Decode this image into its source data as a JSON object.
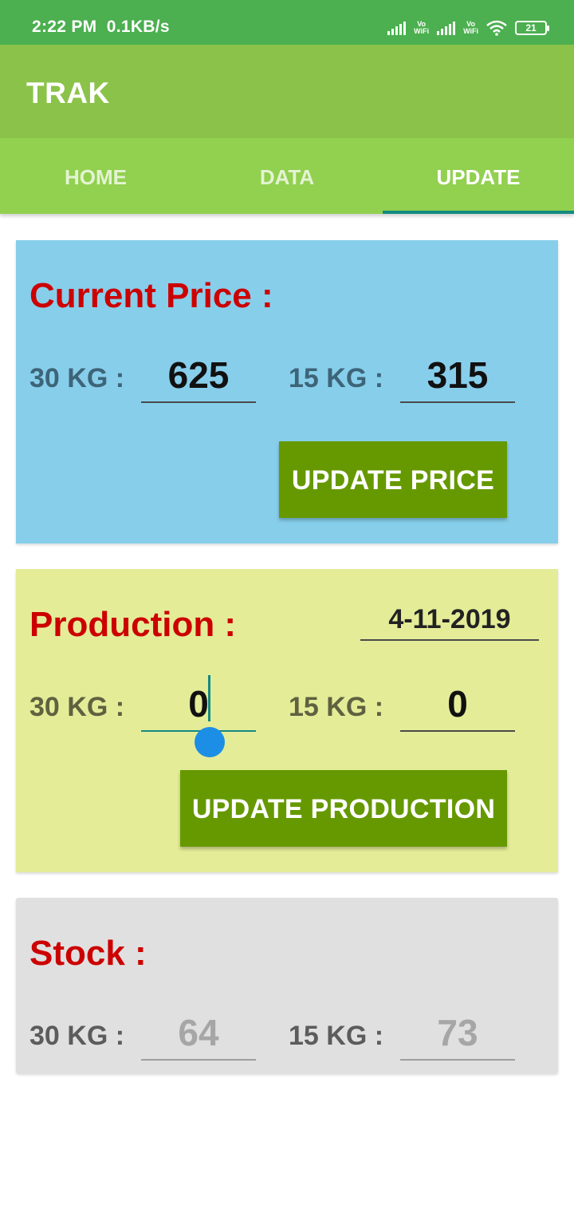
{
  "status_bar": {
    "time": "2:22 PM",
    "speed": "0.1KB/s",
    "vowifi_label": "Vo\nWiFi",
    "battery": "21"
  },
  "app": {
    "title": "TRAK"
  },
  "tabs": [
    {
      "label": "HOME",
      "active": false
    },
    {
      "label": "DATA",
      "active": false
    },
    {
      "label": "UPDATE",
      "active": true
    }
  ],
  "current_price": {
    "heading": "Current Price :",
    "label_30": "30 KG :",
    "label_15": "15 KG :",
    "value_30": "625",
    "value_15": "315",
    "button": "UPDATE PRICE"
  },
  "production": {
    "heading": "Production :",
    "date": "4-11-2019",
    "label_30": "30 KG :",
    "label_15": "15 KG :",
    "value_30": "0",
    "value_15": "0",
    "button": "UPDATE PRODUCTION"
  },
  "stock": {
    "heading": "Stock :",
    "label_30": "30 KG :",
    "label_15": "15 KG :",
    "value_30": "64",
    "value_15": "73"
  },
  "colors": {
    "status_bar": "#4caf50",
    "app_bar": "#8bc34a",
    "tabs": "#92d050",
    "heading_red": "#cc0000",
    "button_green": "#669900",
    "price_card": "#87ceeb",
    "production_card": "#e4ec98",
    "stock_card": "#e0e0e0"
  }
}
